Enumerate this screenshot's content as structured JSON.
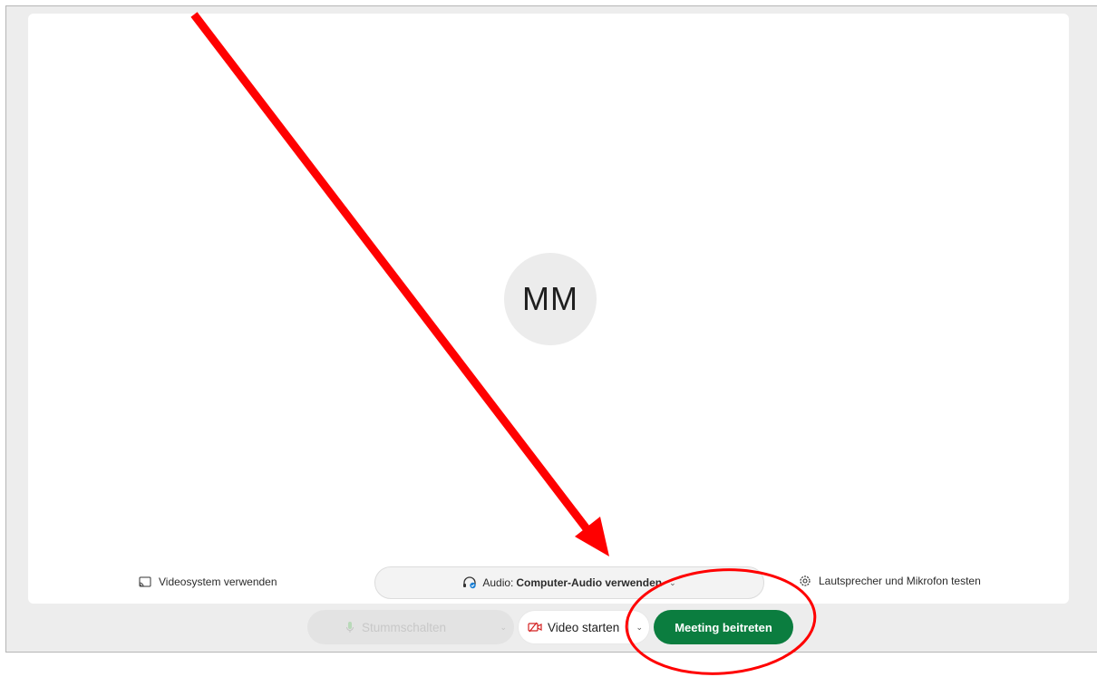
{
  "preview": {
    "avatar_initials": "MM"
  },
  "options": {
    "video_system_label": "Videosystem verwenden",
    "audio_prefix": "Audio:",
    "audio_value": "Computer-Audio verwenden",
    "test_label": "Lautsprecher und Mikrofon testen"
  },
  "controls": {
    "mute_label": "Stummschalten",
    "video_label": "Video starten",
    "join_label": "Meeting beitreten"
  },
  "icons": {
    "cast": "cast-icon",
    "headset": "headset-icon",
    "settings": "gear-icon",
    "microphone": "microphone-icon",
    "video_off": "video-off-icon",
    "chevron": "chevron-down-icon"
  },
  "colors": {
    "join_button": "#0b7d3f",
    "annotation": "#ff0000",
    "panel": "#ffffff",
    "background": "#ededed"
  }
}
